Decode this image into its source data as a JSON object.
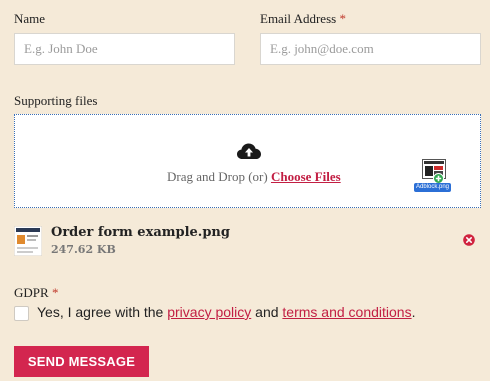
{
  "form": {
    "name_label": "Name",
    "name_placeholder": "E.g. John Doe",
    "email_label": "Email Address",
    "email_required_mark": "*",
    "email_placeholder": "E.g. john@doe.com",
    "files_label": "Supporting files",
    "dropzone_text": "Drag and Drop (or)",
    "dropzone_link": "Choose Files",
    "drag_preview_label": "Adblock.png",
    "uploaded_file": {
      "name": "Order form example.png",
      "size": "247.62 KB"
    },
    "gdpr_label": "GDPR",
    "gdpr_required_mark": "*",
    "consent_prefix": "Yes, I agree with the",
    "consent_link1": "privacy policy",
    "consent_middle": "and",
    "consent_link2": "terms and conditions",
    "consent_suffix": ".",
    "submit_label": "SEND MESSAGE"
  },
  "colors": {
    "background": "#f5ead8",
    "accent": "#d3264f",
    "dropzone_border": "#3b6fb6"
  },
  "icons": [
    "upload-cloud-icon",
    "remove-file-icon",
    "file-thumbnail",
    "drag-file-preview"
  ]
}
